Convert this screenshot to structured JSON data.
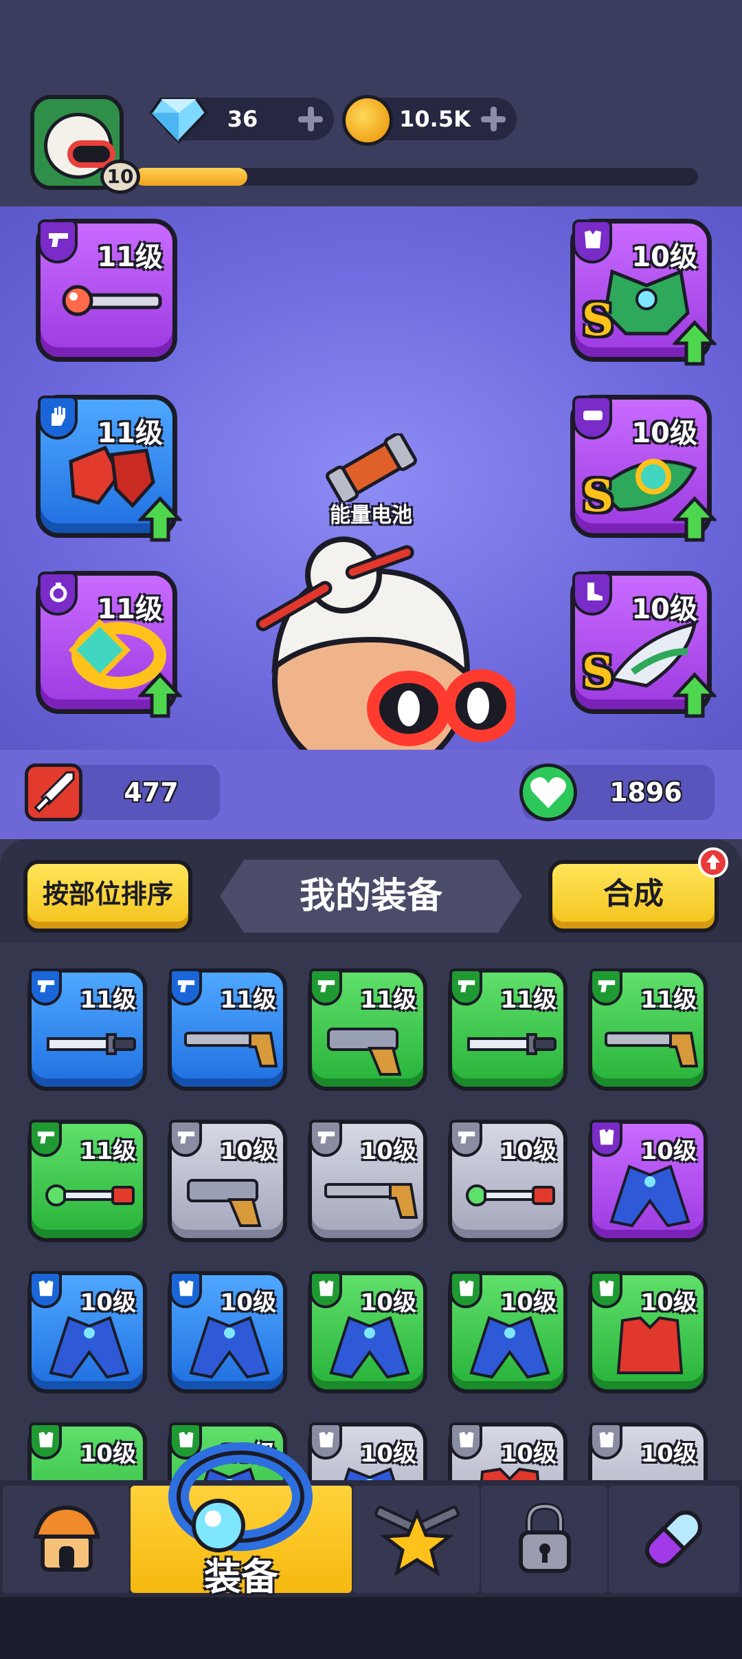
{
  "player": {
    "level": "10",
    "xp_fraction": 0.2
  },
  "currencies": {
    "gems": "36",
    "coins": "10.5K"
  },
  "hero": {
    "battery_label": "能量电池",
    "left_slots": [
      {
        "level": "11级",
        "rarity": "purple",
        "type_icon": "gun-icon",
        "item": "orb-staff",
        "upgrade": false
      },
      {
        "level": "11级",
        "rarity": "blue",
        "type_icon": "glove-icon",
        "item": "red-gloves",
        "upgrade": true
      },
      {
        "level": "11级",
        "rarity": "purple",
        "type_icon": "ring-icon",
        "item": "gold-ring",
        "upgrade": true
      }
    ],
    "right_slots": [
      {
        "level": "10级",
        "rarity": "purple",
        "type_icon": "armor-icon",
        "item": "green-armor",
        "grade": "S",
        "upgrade": true
      },
      {
        "level": "10级",
        "rarity": "purple",
        "type_icon": "belt-icon",
        "item": "jade-belt",
        "grade": "S",
        "upgrade": true
      },
      {
        "level": "10级",
        "rarity": "purple",
        "type_icon": "boot-icon",
        "item": "winged-boots",
        "grade": "S",
        "upgrade": true
      }
    ]
  },
  "stats": {
    "attack": "477",
    "health": "1896"
  },
  "inventory": {
    "sort_button": "按部位排序",
    "title": "我的装备",
    "merge_button": "合成",
    "items": [
      {
        "level": "11级",
        "rarity": "blue",
        "type": "gun",
        "art": "knife"
      },
      {
        "level": "11级",
        "rarity": "blue",
        "type": "gun",
        "art": "shotgun"
      },
      {
        "level": "11级",
        "rarity": "green",
        "type": "gun",
        "art": "pistol"
      },
      {
        "level": "11级",
        "rarity": "green",
        "type": "gun",
        "art": "knife"
      },
      {
        "level": "11级",
        "rarity": "green",
        "type": "gun",
        "art": "shotgun"
      },
      {
        "level": "11级",
        "rarity": "green",
        "type": "gun",
        "art": "wand"
      },
      {
        "level": "10级",
        "rarity": "gray",
        "type": "gun",
        "art": "pistol"
      },
      {
        "level": "10级",
        "rarity": "gray",
        "type": "gun",
        "art": "shotgun"
      },
      {
        "level": "10级",
        "rarity": "gray",
        "type": "gun",
        "art": "wand"
      },
      {
        "level": "10级",
        "rarity": "purple",
        "type": "armor",
        "art": "coat"
      },
      {
        "level": "10级",
        "rarity": "blue",
        "type": "armor",
        "art": "coat"
      },
      {
        "level": "10级",
        "rarity": "blue",
        "type": "armor",
        "art": "coat"
      },
      {
        "level": "10级",
        "rarity": "green",
        "type": "armor",
        "art": "coat"
      },
      {
        "level": "10级",
        "rarity": "green",
        "type": "armor",
        "art": "coat"
      },
      {
        "level": "10级",
        "rarity": "green",
        "type": "armor",
        "art": "vest"
      },
      {
        "level": "10级",
        "rarity": "green",
        "type": "armor",
        "art": "boots"
      },
      {
        "level": "10级",
        "rarity": "green",
        "type": "armor",
        "art": "coat"
      },
      {
        "level": "10级",
        "rarity": "gray",
        "type": "armor",
        "art": "coat"
      },
      {
        "level": "10级",
        "rarity": "gray",
        "type": "armor",
        "art": "vest"
      },
      {
        "level": "10级",
        "rarity": "gray",
        "type": "armor",
        "art": "boots"
      }
    ]
  },
  "nav": {
    "items": [
      {
        "icon": "shop-icon",
        "label": ""
      },
      {
        "icon": "ring-icon",
        "label": "装备",
        "active": true
      },
      {
        "icon": "star-weapons-icon",
        "label": ""
      },
      {
        "icon": "lock-icon",
        "label": ""
      },
      {
        "icon": "capsule-icon",
        "label": ""
      }
    ]
  }
}
